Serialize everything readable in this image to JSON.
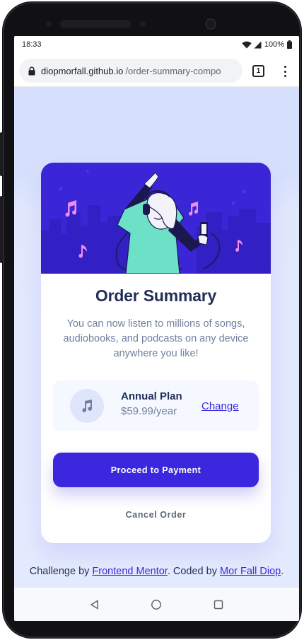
{
  "status_bar": {
    "time": "18:33",
    "battery_percent": "100%",
    "icons": [
      "wifi-icon",
      "signal-icon",
      "battery-icon"
    ]
  },
  "browser": {
    "url_host": "diopmorfall.github.io",
    "url_path": "/order-summary-compo",
    "tab_count": "1",
    "icons": [
      "lock-icon",
      "tabs-icon",
      "kebab-menu-icon"
    ]
  },
  "card": {
    "title": "Order Summary",
    "description": "You can now listen to millions of songs, audiobooks, and podcasts on any device anywhere you like!",
    "plan": {
      "name": "Annual Plan",
      "price": "$59.99/year",
      "change_label": "Change",
      "icon": "music-note-icon"
    },
    "pay_label": "Proceed to Payment",
    "cancel_label": "Cancel Order"
  },
  "attribution": {
    "prefix": "Challenge by ",
    "link1": "Frontend Mentor",
    "middle": ". Coded by ",
    "link2": "Mor Fall Diop",
    "suffix": "."
  },
  "navbar": {
    "icons": [
      "back-triangle-icon",
      "home-circle-icon",
      "recents-square-icon"
    ]
  },
  "colors": {
    "primary": "#3829e0",
    "page_bg": "#e0e8ff",
    "dark_text": "#1f2f56",
    "muted_text": "#717f9e",
    "plan_bg": "#f5f8ff",
    "hero_bg": "#3b27d9"
  }
}
